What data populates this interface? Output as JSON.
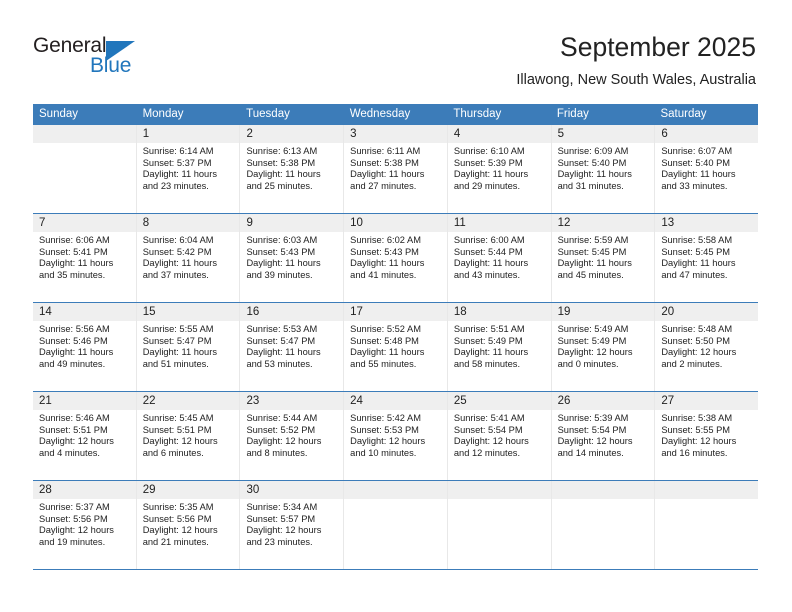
{
  "brand": {
    "name_part1": "General",
    "name_part2": "Blue",
    "accent_color": "#2176bc"
  },
  "header": {
    "month_title": "September 2025",
    "location": "Illawong, New South Wales, Australia"
  },
  "calendar": {
    "header_color": "#3c7cb9",
    "day_band_color": "#efefef",
    "weekdays": [
      "Sunday",
      "Monday",
      "Tuesday",
      "Wednesday",
      "Thursday",
      "Friday",
      "Saturday"
    ],
    "weeks": [
      [
        {
          "day": "",
          "sunrise": "",
          "sunset": "",
          "daylight_line1": "",
          "daylight_line2": ""
        },
        {
          "day": "1",
          "sunrise": "Sunrise: 6:14 AM",
          "sunset": "Sunset: 5:37 PM",
          "daylight_line1": "Daylight: 11 hours",
          "daylight_line2": "and 23 minutes."
        },
        {
          "day": "2",
          "sunrise": "Sunrise: 6:13 AM",
          "sunset": "Sunset: 5:38 PM",
          "daylight_line1": "Daylight: 11 hours",
          "daylight_line2": "and 25 minutes."
        },
        {
          "day": "3",
          "sunrise": "Sunrise: 6:11 AM",
          "sunset": "Sunset: 5:38 PM",
          "daylight_line1": "Daylight: 11 hours",
          "daylight_line2": "and 27 minutes."
        },
        {
          "day": "4",
          "sunrise": "Sunrise: 6:10 AM",
          "sunset": "Sunset: 5:39 PM",
          "daylight_line1": "Daylight: 11 hours",
          "daylight_line2": "and 29 minutes."
        },
        {
          "day": "5",
          "sunrise": "Sunrise: 6:09 AM",
          "sunset": "Sunset: 5:40 PM",
          "daylight_line1": "Daylight: 11 hours",
          "daylight_line2": "and 31 minutes."
        },
        {
          "day": "6",
          "sunrise": "Sunrise: 6:07 AM",
          "sunset": "Sunset: 5:40 PM",
          "daylight_line1": "Daylight: 11 hours",
          "daylight_line2": "and 33 minutes."
        }
      ],
      [
        {
          "day": "7",
          "sunrise": "Sunrise: 6:06 AM",
          "sunset": "Sunset: 5:41 PM",
          "daylight_line1": "Daylight: 11 hours",
          "daylight_line2": "and 35 minutes."
        },
        {
          "day": "8",
          "sunrise": "Sunrise: 6:04 AM",
          "sunset": "Sunset: 5:42 PM",
          "daylight_line1": "Daylight: 11 hours",
          "daylight_line2": "and 37 minutes."
        },
        {
          "day": "9",
          "sunrise": "Sunrise: 6:03 AM",
          "sunset": "Sunset: 5:43 PM",
          "daylight_line1": "Daylight: 11 hours",
          "daylight_line2": "and 39 minutes."
        },
        {
          "day": "10",
          "sunrise": "Sunrise: 6:02 AM",
          "sunset": "Sunset: 5:43 PM",
          "daylight_line1": "Daylight: 11 hours",
          "daylight_line2": "and 41 minutes."
        },
        {
          "day": "11",
          "sunrise": "Sunrise: 6:00 AM",
          "sunset": "Sunset: 5:44 PM",
          "daylight_line1": "Daylight: 11 hours",
          "daylight_line2": "and 43 minutes."
        },
        {
          "day": "12",
          "sunrise": "Sunrise: 5:59 AM",
          "sunset": "Sunset: 5:45 PM",
          "daylight_line1": "Daylight: 11 hours",
          "daylight_line2": "and 45 minutes."
        },
        {
          "day": "13",
          "sunrise": "Sunrise: 5:58 AM",
          "sunset": "Sunset: 5:45 PM",
          "daylight_line1": "Daylight: 11 hours",
          "daylight_line2": "and 47 minutes."
        }
      ],
      [
        {
          "day": "14",
          "sunrise": "Sunrise: 5:56 AM",
          "sunset": "Sunset: 5:46 PM",
          "daylight_line1": "Daylight: 11 hours",
          "daylight_line2": "and 49 minutes."
        },
        {
          "day": "15",
          "sunrise": "Sunrise: 5:55 AM",
          "sunset": "Sunset: 5:47 PM",
          "daylight_line1": "Daylight: 11 hours",
          "daylight_line2": "and 51 minutes."
        },
        {
          "day": "16",
          "sunrise": "Sunrise: 5:53 AM",
          "sunset": "Sunset: 5:47 PM",
          "daylight_line1": "Daylight: 11 hours",
          "daylight_line2": "and 53 minutes."
        },
        {
          "day": "17",
          "sunrise": "Sunrise: 5:52 AM",
          "sunset": "Sunset: 5:48 PM",
          "daylight_line1": "Daylight: 11 hours",
          "daylight_line2": "and 55 minutes."
        },
        {
          "day": "18",
          "sunrise": "Sunrise: 5:51 AM",
          "sunset": "Sunset: 5:49 PM",
          "daylight_line1": "Daylight: 11 hours",
          "daylight_line2": "and 58 minutes."
        },
        {
          "day": "19",
          "sunrise": "Sunrise: 5:49 AM",
          "sunset": "Sunset: 5:49 PM",
          "daylight_line1": "Daylight: 12 hours",
          "daylight_line2": "and 0 minutes."
        },
        {
          "day": "20",
          "sunrise": "Sunrise: 5:48 AM",
          "sunset": "Sunset: 5:50 PM",
          "daylight_line1": "Daylight: 12 hours",
          "daylight_line2": "and 2 minutes."
        }
      ],
      [
        {
          "day": "21",
          "sunrise": "Sunrise: 5:46 AM",
          "sunset": "Sunset: 5:51 PM",
          "daylight_line1": "Daylight: 12 hours",
          "daylight_line2": "and 4 minutes."
        },
        {
          "day": "22",
          "sunrise": "Sunrise: 5:45 AM",
          "sunset": "Sunset: 5:51 PM",
          "daylight_line1": "Daylight: 12 hours",
          "daylight_line2": "and 6 minutes."
        },
        {
          "day": "23",
          "sunrise": "Sunrise: 5:44 AM",
          "sunset": "Sunset: 5:52 PM",
          "daylight_line1": "Daylight: 12 hours",
          "daylight_line2": "and 8 minutes."
        },
        {
          "day": "24",
          "sunrise": "Sunrise: 5:42 AM",
          "sunset": "Sunset: 5:53 PM",
          "daylight_line1": "Daylight: 12 hours",
          "daylight_line2": "and 10 minutes."
        },
        {
          "day": "25",
          "sunrise": "Sunrise: 5:41 AM",
          "sunset": "Sunset: 5:54 PM",
          "daylight_line1": "Daylight: 12 hours",
          "daylight_line2": "and 12 minutes."
        },
        {
          "day": "26",
          "sunrise": "Sunrise: 5:39 AM",
          "sunset": "Sunset: 5:54 PM",
          "daylight_line1": "Daylight: 12 hours",
          "daylight_line2": "and 14 minutes."
        },
        {
          "day": "27",
          "sunrise": "Sunrise: 5:38 AM",
          "sunset": "Sunset: 5:55 PM",
          "daylight_line1": "Daylight: 12 hours",
          "daylight_line2": "and 16 minutes."
        }
      ],
      [
        {
          "day": "28",
          "sunrise": "Sunrise: 5:37 AM",
          "sunset": "Sunset: 5:56 PM",
          "daylight_line1": "Daylight: 12 hours",
          "daylight_line2": "and 19 minutes."
        },
        {
          "day": "29",
          "sunrise": "Sunrise: 5:35 AM",
          "sunset": "Sunset: 5:56 PM",
          "daylight_line1": "Daylight: 12 hours",
          "daylight_line2": "and 21 minutes."
        },
        {
          "day": "30",
          "sunrise": "Sunrise: 5:34 AM",
          "sunset": "Sunset: 5:57 PM",
          "daylight_line1": "Daylight: 12 hours",
          "daylight_line2": "and 23 minutes."
        },
        {
          "day": "",
          "sunrise": "",
          "sunset": "",
          "daylight_line1": "",
          "daylight_line2": ""
        },
        {
          "day": "",
          "sunrise": "",
          "sunset": "",
          "daylight_line1": "",
          "daylight_line2": ""
        },
        {
          "day": "",
          "sunrise": "",
          "sunset": "",
          "daylight_line1": "",
          "daylight_line2": ""
        },
        {
          "day": "",
          "sunrise": "",
          "sunset": "",
          "daylight_line1": "",
          "daylight_line2": ""
        }
      ]
    ]
  }
}
